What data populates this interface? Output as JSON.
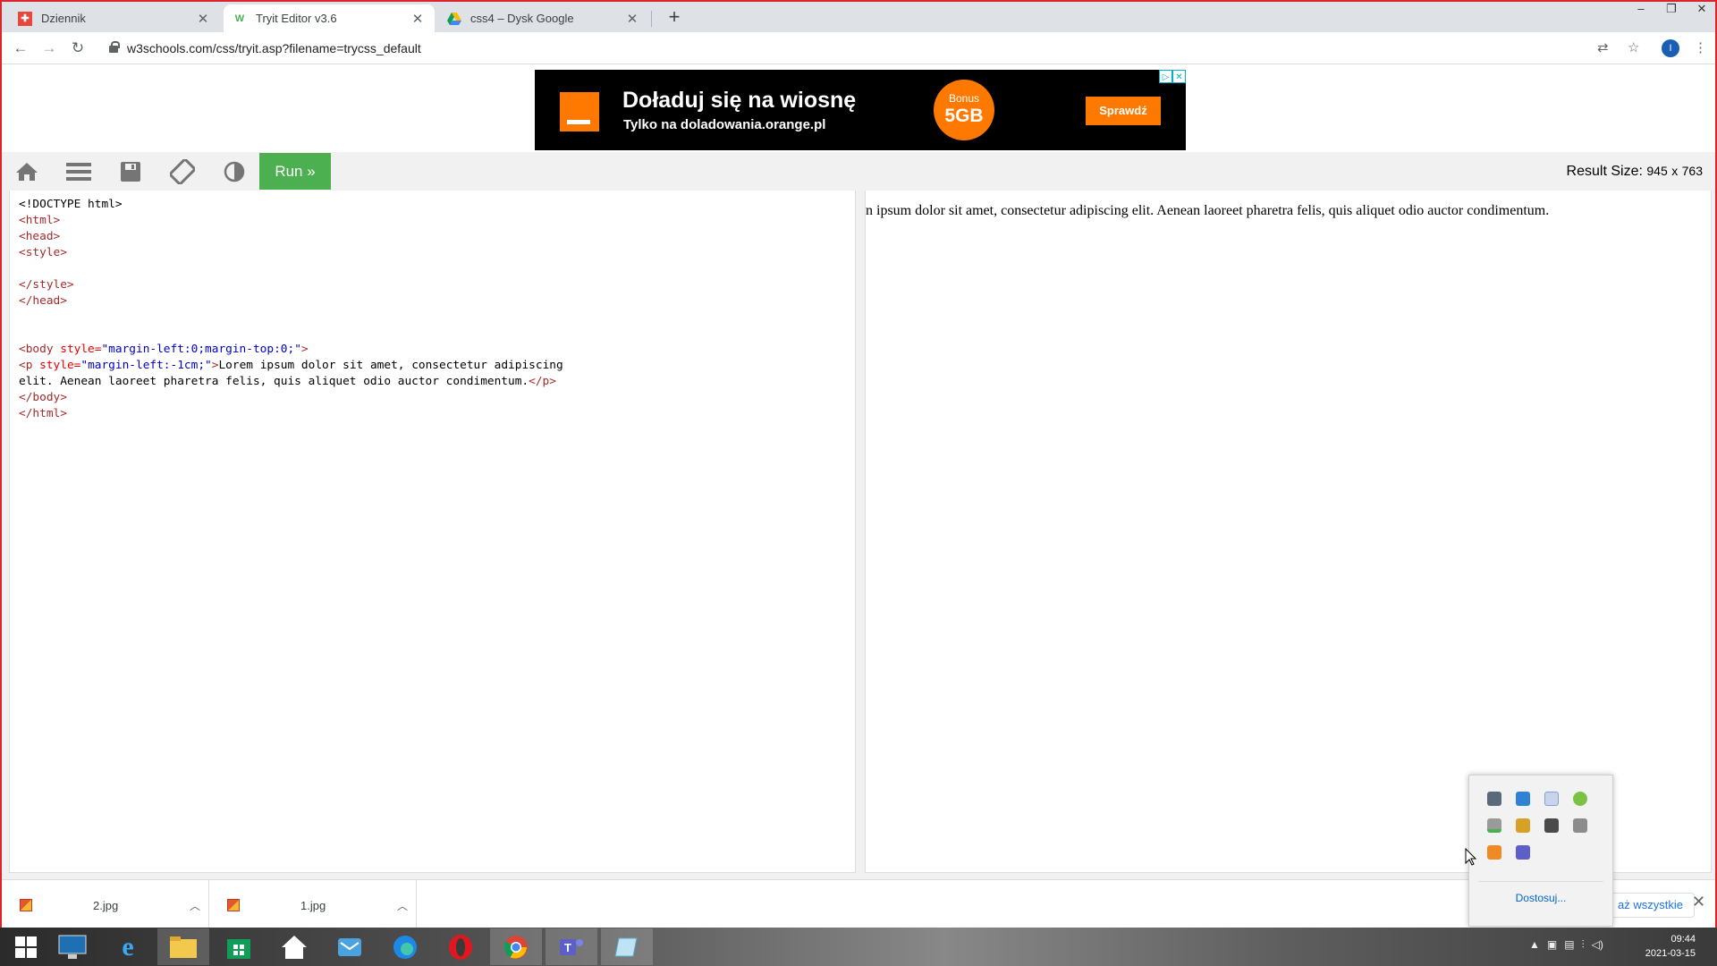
{
  "browser": {
    "tabs": [
      {
        "title": "Dziennik",
        "icon": "dziennik-favicon",
        "active": false
      },
      {
        "title": "Tryit Editor v3.6",
        "icon": "w3schools-favicon",
        "active": true
      },
      {
        "title": "css4 – Dysk Google",
        "icon": "google-drive-favicon",
        "active": false
      }
    ],
    "new_tab": "+",
    "url": "w3schools.com/css/tryit.asp?filename=trycss_default",
    "profile_initial": "I"
  },
  "ad": {
    "headline": "Doładuj się na wiosnę",
    "subline": "Tylko na doladowania.orange.pl",
    "bonus_label": "Bonus",
    "bonus_value": "5GB",
    "cta": "Sprawdź"
  },
  "toolbar": {
    "run_label": "Run »",
    "result_size_label": "Result Size:",
    "result_width": "945",
    "result_x": "x",
    "result_height": "763"
  },
  "editor": {
    "lines": [
      [
        {
          "c": "p",
          "t": "<!DOCTYPE html>"
        }
      ],
      [
        {
          "c": "t",
          "t": "<html>"
        }
      ],
      [
        {
          "c": "t",
          "t": "<head>"
        }
      ],
      [
        {
          "c": "t",
          "t": "<style>"
        }
      ],
      [],
      [
        {
          "c": "t",
          "t": "</style>"
        }
      ],
      [
        {
          "c": "t",
          "t": "</head>"
        }
      ],
      [],
      [],
      [
        {
          "c": "t",
          "t": "<body"
        },
        {
          "c": "a",
          "t": " style="
        },
        {
          "c": "v",
          "t": "\"margin-left:0;margin-top:0;\""
        },
        {
          "c": "t",
          "t": ">"
        }
      ],
      [
        {
          "c": "t",
          "t": "<p"
        },
        {
          "c": "a",
          "t": " style="
        },
        {
          "c": "v",
          "t": "\"margin-left:-1cm;\""
        },
        {
          "c": "t",
          "t": ">"
        },
        {
          "c": "p",
          "t": "Lorem ipsum dolor sit amet, consectetur adipiscing"
        }
      ],
      [
        {
          "c": "p",
          "t": "elit. Aenean laoreet pharetra felis, quis aliquet odio auctor condimentum."
        },
        {
          "c": "t",
          "t": "</p>"
        }
      ],
      [
        {
          "c": "t",
          "t": "</body>"
        }
      ],
      [
        {
          "c": "t",
          "t": "</html>"
        }
      ]
    ]
  },
  "result": {
    "text": "n ipsum dolor sit amet, consectetur adipiscing elit. Aenean laoreet pharetra felis, quis aliquet odio auctor condimentum."
  },
  "downloads": {
    "items": [
      {
        "name": "2.jpg"
      },
      {
        "name": "1.jpg"
      }
    ],
    "show_all": "aż wszystkie"
  },
  "tray_popup": {
    "icons": [
      "display-icon",
      "network-icon",
      "bluetooth-icon",
      "update-icon",
      "security-icon",
      "package-icon",
      "keyboard-icon",
      "printer-icon",
      "java-icon",
      "teams-tray-icon"
    ],
    "customize_label": "Dostosuj..."
  },
  "taskbar": {
    "apps": [
      "start-icon",
      "lenovo-icon",
      "ie-icon",
      "explorer-icon",
      "store-icon",
      "home-icon",
      "mail-icon",
      "edge-icon",
      "opera-icon",
      "chrome-icon",
      "teams-icon",
      "notepad-icon"
    ],
    "time": "09:44",
    "date": "2021-03-15"
  }
}
